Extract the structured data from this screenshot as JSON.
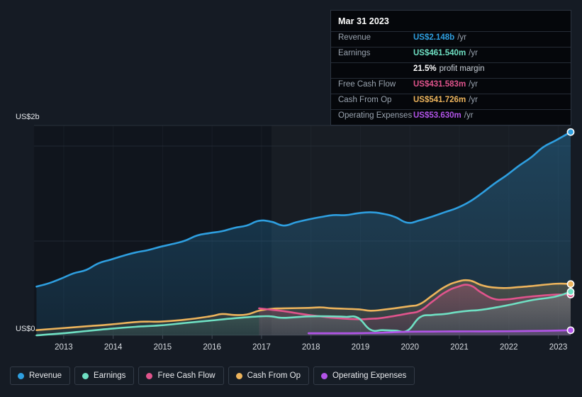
{
  "tooltip": {
    "date": "Mar 31 2023",
    "rows": [
      {
        "label": "Revenue",
        "value": "US$2.148b",
        "unit": "/yr",
        "color_key": "revenue"
      },
      {
        "label": "Earnings",
        "value": "US$461.540m",
        "unit": "/yr",
        "color_key": "earnings"
      },
      {
        "label": "",
        "value": "21.5%",
        "unit": "profit margin",
        "color_key": "margin"
      },
      {
        "label": "Free Cash Flow",
        "value": "US$431.583m",
        "unit": "/yr",
        "color_key": "fcf"
      },
      {
        "label": "Cash From Op",
        "value": "US$541.726m",
        "unit": "/yr",
        "color_key": "cfo"
      },
      {
        "label": "Operating Expenses",
        "value": "US$53.630m",
        "unit": "/yr",
        "color_key": "opex"
      }
    ]
  },
  "legend": {
    "items": [
      {
        "label": "Revenue",
        "color": "#2e9fe0"
      },
      {
        "label": "Earnings",
        "color": "#6fe0c3"
      },
      {
        "label": "Free Cash Flow",
        "color": "#e0548c"
      },
      {
        "label": "Cash From Op",
        "color": "#edb45c"
      },
      {
        "label": "Operating Expenses",
        "color": "#b254e8"
      }
    ]
  },
  "axes": {
    "y_top_label": "US$2b",
    "y_zero_label": "US$0",
    "x_ticks": [
      "2013",
      "2014",
      "2015",
      "2016",
      "2017",
      "2018",
      "2019",
      "2020",
      "2021",
      "2022",
      "2023"
    ]
  },
  "colors": {
    "background": "#151b24",
    "plot_background": "#10151d",
    "grid": "#2a313c",
    "revenue": "#2e9fe0",
    "earnings": "#6fe0c3",
    "fcf": "#e0548c",
    "cfo": "#edb45c",
    "opex": "#b254e8",
    "margin": "#ffffff"
  },
  "chart_data": {
    "type": "area",
    "title": "",
    "xlabel": "",
    "ylabel": "US$",
    "ylim": [
      0,
      2.2
    ],
    "xlim": [
      2012.4,
      2023.25
    ],
    "y_unit": "billions USD",
    "grid": true,
    "legend_position": "bottom-left",
    "x_tick_values": [
      2013,
      2014,
      2015,
      2016,
      2017,
      2018,
      2019,
      2020,
      2021,
      2022,
      2023
    ],
    "y_tick_values": [
      0,
      2
    ],
    "y_tick_labels": [
      "US$0",
      "US$2b"
    ],
    "annotations": {
      "tooltip_date": "Mar 31 2023",
      "final_values": {
        "revenue": 2.148,
        "earnings": 0.46154,
        "free_cash_flow": 0.431583,
        "cash_from_op": 0.541726,
        "operating_expenses": 0.05363
      }
    },
    "series": [
      {
        "name": "Revenue",
        "color": "#2e9fe0",
        "x": [
          2012.45,
          2012.7,
          2012.95,
          2013.2,
          2013.45,
          2013.7,
          2013.95,
          2014.2,
          2014.45,
          2014.7,
          2014.95,
          2015.2,
          2015.45,
          2015.7,
          2015.95,
          2016.2,
          2016.45,
          2016.7,
          2016.95,
          2017.2,
          2017.45,
          2017.7,
          2017.95,
          2018.2,
          2018.45,
          2018.7,
          2018.95,
          2019.2,
          2019.45,
          2019.7,
          2019.95,
          2020.2,
          2020.45,
          2020.7,
          2020.95,
          2021.2,
          2021.45,
          2021.7,
          2021.95,
          2022.2,
          2022.45,
          2022.7,
          2022.95,
          2023.25
        ],
        "values": [
          0.515,
          0.55,
          0.6,
          0.655,
          0.69,
          0.76,
          0.8,
          0.84,
          0.875,
          0.9,
          0.935,
          0.965,
          1.0,
          1.055,
          1.08,
          1.1,
          1.135,
          1.16,
          1.21,
          1.2,
          1.16,
          1.195,
          1.225,
          1.25,
          1.27,
          1.27,
          1.29,
          1.3,
          1.285,
          1.25,
          1.19,
          1.215,
          1.255,
          1.3,
          1.345,
          1.41,
          1.5,
          1.6,
          1.69,
          1.79,
          1.88,
          1.99,
          2.06,
          2.148
        ]
      },
      {
        "name": "Earnings",
        "color": "#6fe0c3",
        "x": [
          2012.45,
          2012.95,
          2013.45,
          2013.95,
          2014.45,
          2014.95,
          2015.45,
          2015.95,
          2016.45,
          2016.95,
          2017.2,
          2017.45,
          2017.95,
          2018.45,
          2018.7,
          2018.95,
          2019.2,
          2019.45,
          2019.7,
          2019.95,
          2020.2,
          2020.45,
          2020.7,
          2020.95,
          2021.2,
          2021.45,
          2021.95,
          2022.45,
          2022.95,
          2023.25
        ],
        "values": [
          0.0,
          0.02,
          0.045,
          0.07,
          0.09,
          0.105,
          0.13,
          0.155,
          0.18,
          0.2,
          0.2,
          0.185,
          0.2,
          0.2,
          0.195,
          0.185,
          0.06,
          0.055,
          0.05,
          0.05,
          0.19,
          0.215,
          0.225,
          0.245,
          0.26,
          0.27,
          0.315,
          0.37,
          0.41,
          0.4615
        ]
      },
      {
        "name": "Free Cash Flow",
        "color": "#e0548c",
        "x": [
          2016.95,
          2017.2,
          2017.45,
          2017.7,
          2017.95,
          2018.2,
          2018.45,
          2018.95,
          2019.2,
          2019.45,
          2019.95,
          2020.2,
          2020.45,
          2020.7,
          2020.95,
          2021.2,
          2021.45,
          2021.7,
          2021.95,
          2022.2,
          2022.45,
          2022.95,
          2023.25
        ],
        "values": [
          0.285,
          0.27,
          0.255,
          0.235,
          0.215,
          0.2,
          0.185,
          0.17,
          0.175,
          0.185,
          0.23,
          0.26,
          0.355,
          0.45,
          0.51,
          0.53,
          0.45,
          0.385,
          0.38,
          0.395,
          0.41,
          0.43,
          0.4316
        ]
      },
      {
        "name": "Cash From Op",
        "color": "#edb45c",
        "x": [
          2012.45,
          2012.95,
          2013.45,
          2013.95,
          2014.45,
          2014.7,
          2014.95,
          2015.45,
          2015.95,
          2016.2,
          2016.45,
          2016.7,
          2016.95,
          2017.2,
          2017.45,
          2017.95,
          2018.2,
          2018.45,
          2018.95,
          2019.2,
          2019.45,
          2019.95,
          2020.2,
          2020.45,
          2020.7,
          2020.95,
          2021.2,
          2021.45,
          2021.7,
          2021.95,
          2022.2,
          2022.45,
          2022.95,
          2023.25
        ],
        "values": [
          0.055,
          0.075,
          0.095,
          0.115,
          0.14,
          0.145,
          0.145,
          0.165,
          0.2,
          0.225,
          0.215,
          0.22,
          0.26,
          0.28,
          0.285,
          0.29,
          0.295,
          0.285,
          0.275,
          0.26,
          0.27,
          0.305,
          0.33,
          0.42,
          0.51,
          0.565,
          0.58,
          0.53,
          0.505,
          0.5,
          0.51,
          0.52,
          0.545,
          0.5417
        ]
      },
      {
        "name": "Operating Expenses",
        "color": "#b254e8",
        "x": [
          2017.95,
          2018.45,
          2018.95,
          2019.45,
          2019.95,
          2020.45,
          2020.95,
          2021.45,
          2021.95,
          2022.45,
          2022.95,
          2023.25
        ],
        "values": [
          0.022,
          0.022,
          0.023,
          0.028,
          0.038,
          0.04,
          0.042,
          0.042,
          0.043,
          0.046,
          0.05,
          0.0536
        ]
      }
    ]
  }
}
